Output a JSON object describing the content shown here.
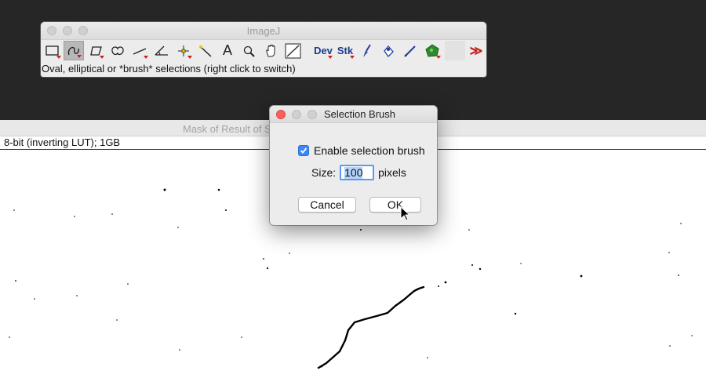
{
  "imagej": {
    "title": "ImageJ",
    "status": "Oval, elliptical or *brush* selections (right click to switch)",
    "tools": [
      {
        "name": "rectangle-tool"
      },
      {
        "name": "oval-brush-tool"
      },
      {
        "name": "polygon-tool"
      },
      {
        "name": "freehand-tool"
      },
      {
        "name": "line-tool"
      },
      {
        "name": "angle-tool"
      },
      {
        "name": "point-tool"
      },
      {
        "name": "wand-tool"
      },
      {
        "name": "text-tool",
        "label": "A"
      },
      {
        "name": "zoom-tool"
      },
      {
        "name": "hand-tool"
      },
      {
        "name": "color-picker-tool"
      },
      {
        "name": "developer-menu",
        "label": "Dev"
      },
      {
        "name": "stacks-menu",
        "label": "Stk"
      },
      {
        "name": "brush-tool"
      },
      {
        "name": "flood-fill-tool"
      },
      {
        "name": "pencil-tool"
      },
      {
        "name": "overlay-brush-tool"
      },
      {
        "name": "more-tools",
        "label": "≫"
      }
    ]
  },
  "image_window": {
    "title": "Mask of Result of S",
    "info": "8-bit (inverting LUT); 1GB"
  },
  "dialog": {
    "title": "Selection Brush",
    "checkbox_label": "Enable selection brush",
    "checkbox_checked": true,
    "size_label": "Size:",
    "size_value": "100",
    "size_unit": "pixels",
    "cancel_label": "Cancel",
    "ok_label": "OK"
  }
}
